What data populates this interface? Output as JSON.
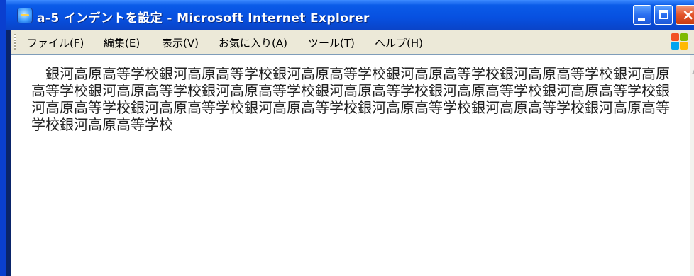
{
  "window": {
    "title": "a-5 インデントを設定 - Microsoft Internet Explorer",
    "icon": "ie-page-icon",
    "buttons": {
      "minimize": "minimize-icon",
      "maximize": "maximize-icon",
      "close": "×"
    }
  },
  "menubar": {
    "items": [
      {
        "label": "ファイル(F)"
      },
      {
        "label": "編集(E)"
      },
      {
        "label": "表示(V)"
      },
      {
        "label": "お気に入り(A)"
      },
      {
        "label": "ツール(T)"
      },
      {
        "label": "ヘルプ(H)"
      }
    ],
    "logo": "windows-flag-logo"
  },
  "page": {
    "paragraph": "銀河高原高等学校銀河高原高等学校銀河高原高等学校銀河高原高等学校銀河高原高等学校銀河高原高等学校銀河高原高等学校銀河高原高等学校銀河高原高等学校銀河高原高等学校銀河高原高等学校銀河高原高等学校銀河高原高等学校銀河高原高等学校銀河高原高等学校銀河高原高等学校銀河高原高等学校銀河高原高等学校"
  },
  "colors": {
    "titlebar": "#0a5be8",
    "menubar": "#ece9d8",
    "close_button": "#e2542a"
  }
}
